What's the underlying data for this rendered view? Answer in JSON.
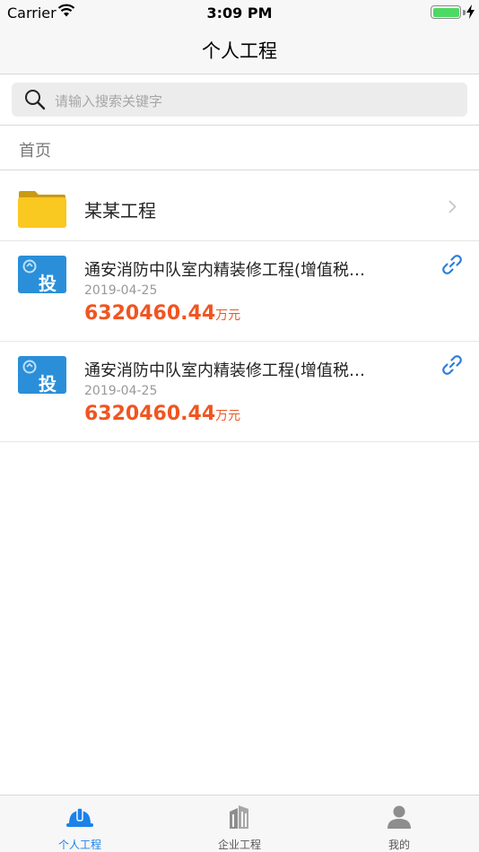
{
  "status_bar": {
    "carrier": "Carrier",
    "time": "3:09 PM",
    "battery_level": 1.0
  },
  "nav": {
    "title": "个人工程"
  },
  "search": {
    "placeholder": "请输入搜索关键字"
  },
  "breadcrumb": {
    "label": "首页"
  },
  "folder": {
    "label": "某某工程",
    "icon": "folder-icon"
  },
  "projects": [
    {
      "badge": "投",
      "title": "通安消防中队室内精装修工程(增值税…",
      "date": "2019-04-25",
      "amount": "6320460.44",
      "unit": "万元"
    },
    {
      "badge": "投",
      "title": "通安消防中队室内精装修工程(增值税…",
      "date": "2019-04-25",
      "amount": "6320460.44",
      "unit": "万元"
    }
  ],
  "tabs": [
    {
      "label": "个人工程",
      "icon": "hard-hat-icon",
      "active": true
    },
    {
      "label": "企业工程",
      "icon": "building-icon",
      "active": false
    },
    {
      "label": "我的",
      "icon": "person-icon",
      "active": false
    }
  ],
  "colors": {
    "accent": "#1a82e8",
    "amount": "#f05521",
    "folder": "#f9c821",
    "badge": "#2a8fd8"
  }
}
